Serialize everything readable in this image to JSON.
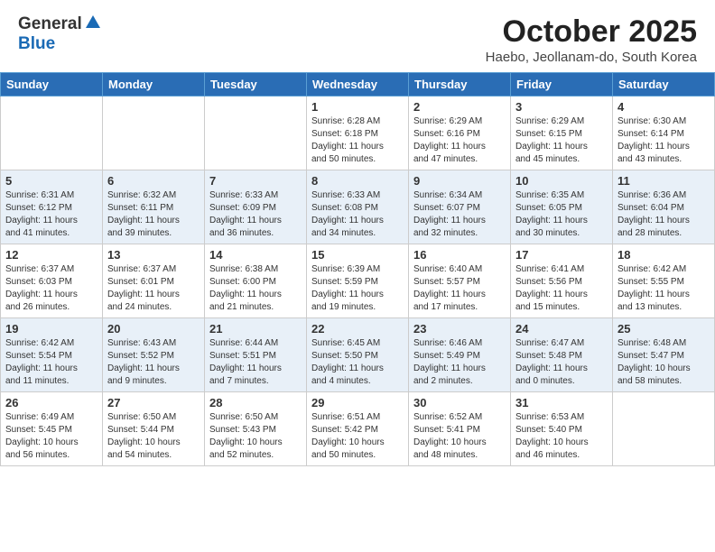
{
  "header": {
    "logo_general": "General",
    "logo_blue": "Blue",
    "month_title": "October 2025",
    "location": "Haebo, Jeollanam-do, South Korea"
  },
  "weekdays": [
    "Sunday",
    "Monday",
    "Tuesday",
    "Wednesday",
    "Thursday",
    "Friday",
    "Saturday"
  ],
  "weeks": [
    [
      {
        "day": "",
        "info": ""
      },
      {
        "day": "",
        "info": ""
      },
      {
        "day": "",
        "info": ""
      },
      {
        "day": "1",
        "info": "Sunrise: 6:28 AM\nSunset: 6:18 PM\nDaylight: 11 hours\nand 50 minutes."
      },
      {
        "day": "2",
        "info": "Sunrise: 6:29 AM\nSunset: 6:16 PM\nDaylight: 11 hours\nand 47 minutes."
      },
      {
        "day": "3",
        "info": "Sunrise: 6:29 AM\nSunset: 6:15 PM\nDaylight: 11 hours\nand 45 minutes."
      },
      {
        "day": "4",
        "info": "Sunrise: 6:30 AM\nSunset: 6:14 PM\nDaylight: 11 hours\nand 43 minutes."
      }
    ],
    [
      {
        "day": "5",
        "info": "Sunrise: 6:31 AM\nSunset: 6:12 PM\nDaylight: 11 hours\nand 41 minutes."
      },
      {
        "day": "6",
        "info": "Sunrise: 6:32 AM\nSunset: 6:11 PM\nDaylight: 11 hours\nand 39 minutes."
      },
      {
        "day": "7",
        "info": "Sunrise: 6:33 AM\nSunset: 6:09 PM\nDaylight: 11 hours\nand 36 minutes."
      },
      {
        "day": "8",
        "info": "Sunrise: 6:33 AM\nSunset: 6:08 PM\nDaylight: 11 hours\nand 34 minutes."
      },
      {
        "day": "9",
        "info": "Sunrise: 6:34 AM\nSunset: 6:07 PM\nDaylight: 11 hours\nand 32 minutes."
      },
      {
        "day": "10",
        "info": "Sunrise: 6:35 AM\nSunset: 6:05 PM\nDaylight: 11 hours\nand 30 minutes."
      },
      {
        "day": "11",
        "info": "Sunrise: 6:36 AM\nSunset: 6:04 PM\nDaylight: 11 hours\nand 28 minutes."
      }
    ],
    [
      {
        "day": "12",
        "info": "Sunrise: 6:37 AM\nSunset: 6:03 PM\nDaylight: 11 hours\nand 26 minutes."
      },
      {
        "day": "13",
        "info": "Sunrise: 6:37 AM\nSunset: 6:01 PM\nDaylight: 11 hours\nand 24 minutes."
      },
      {
        "day": "14",
        "info": "Sunrise: 6:38 AM\nSunset: 6:00 PM\nDaylight: 11 hours\nand 21 minutes."
      },
      {
        "day": "15",
        "info": "Sunrise: 6:39 AM\nSunset: 5:59 PM\nDaylight: 11 hours\nand 19 minutes."
      },
      {
        "day": "16",
        "info": "Sunrise: 6:40 AM\nSunset: 5:57 PM\nDaylight: 11 hours\nand 17 minutes."
      },
      {
        "day": "17",
        "info": "Sunrise: 6:41 AM\nSunset: 5:56 PM\nDaylight: 11 hours\nand 15 minutes."
      },
      {
        "day": "18",
        "info": "Sunrise: 6:42 AM\nSunset: 5:55 PM\nDaylight: 11 hours\nand 13 minutes."
      }
    ],
    [
      {
        "day": "19",
        "info": "Sunrise: 6:42 AM\nSunset: 5:54 PM\nDaylight: 11 hours\nand 11 minutes."
      },
      {
        "day": "20",
        "info": "Sunrise: 6:43 AM\nSunset: 5:52 PM\nDaylight: 11 hours\nand 9 minutes."
      },
      {
        "day": "21",
        "info": "Sunrise: 6:44 AM\nSunset: 5:51 PM\nDaylight: 11 hours\nand 7 minutes."
      },
      {
        "day": "22",
        "info": "Sunrise: 6:45 AM\nSunset: 5:50 PM\nDaylight: 11 hours\nand 4 minutes."
      },
      {
        "day": "23",
        "info": "Sunrise: 6:46 AM\nSunset: 5:49 PM\nDaylight: 11 hours\nand 2 minutes."
      },
      {
        "day": "24",
        "info": "Sunrise: 6:47 AM\nSunset: 5:48 PM\nDaylight: 11 hours\nand 0 minutes."
      },
      {
        "day": "25",
        "info": "Sunrise: 6:48 AM\nSunset: 5:47 PM\nDaylight: 10 hours\nand 58 minutes."
      }
    ],
    [
      {
        "day": "26",
        "info": "Sunrise: 6:49 AM\nSunset: 5:45 PM\nDaylight: 10 hours\nand 56 minutes."
      },
      {
        "day": "27",
        "info": "Sunrise: 6:50 AM\nSunset: 5:44 PM\nDaylight: 10 hours\nand 54 minutes."
      },
      {
        "day": "28",
        "info": "Sunrise: 6:50 AM\nSunset: 5:43 PM\nDaylight: 10 hours\nand 52 minutes."
      },
      {
        "day": "29",
        "info": "Sunrise: 6:51 AM\nSunset: 5:42 PM\nDaylight: 10 hours\nand 50 minutes."
      },
      {
        "day": "30",
        "info": "Sunrise: 6:52 AM\nSunset: 5:41 PM\nDaylight: 10 hours\nand 48 minutes."
      },
      {
        "day": "31",
        "info": "Sunrise: 6:53 AM\nSunset: 5:40 PM\nDaylight: 10 hours\nand 46 minutes."
      },
      {
        "day": "",
        "info": ""
      }
    ]
  ]
}
